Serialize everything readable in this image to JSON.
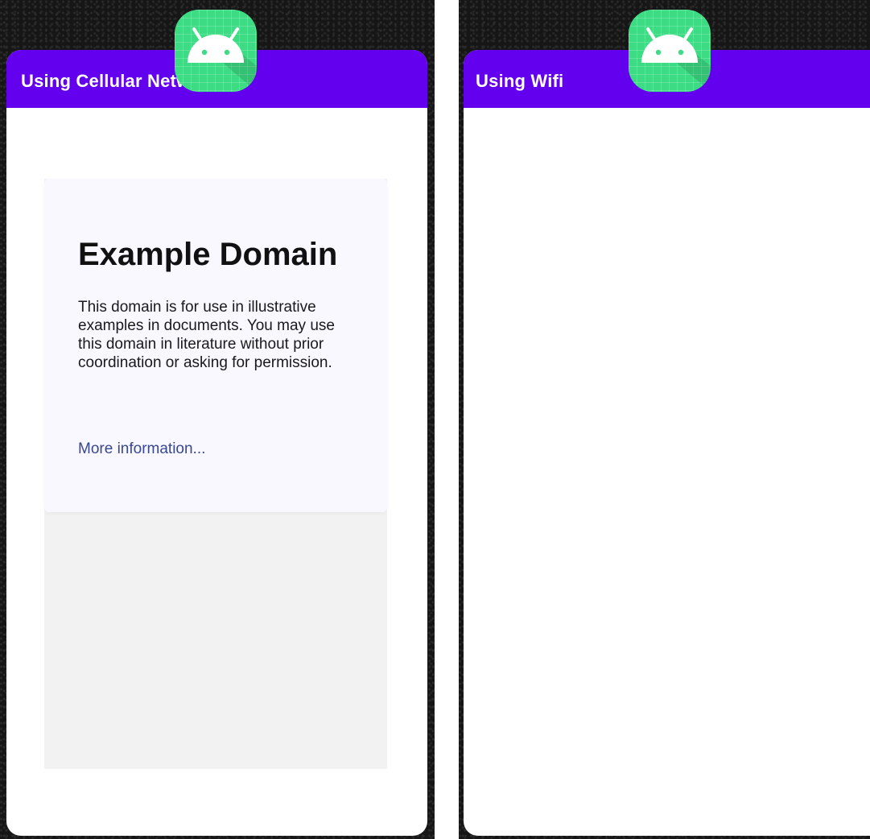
{
  "left_panel": {
    "app_bar_title": "Using Cellular Network",
    "web_content": {
      "heading": "Example Domain",
      "body": "This domain is for use in illustrative examples in documents. You may use this domain in literature without prior coordination or asking for permission.",
      "link": "More information..."
    }
  },
  "right_panel": {
    "app_bar_title": "Using Wifi"
  },
  "colors": {
    "app_bar": "#6300ee",
    "launcher_icon": "#3ddc84",
    "link": "#38488f"
  },
  "icons": {
    "launcher": "android-robot-icon"
  }
}
